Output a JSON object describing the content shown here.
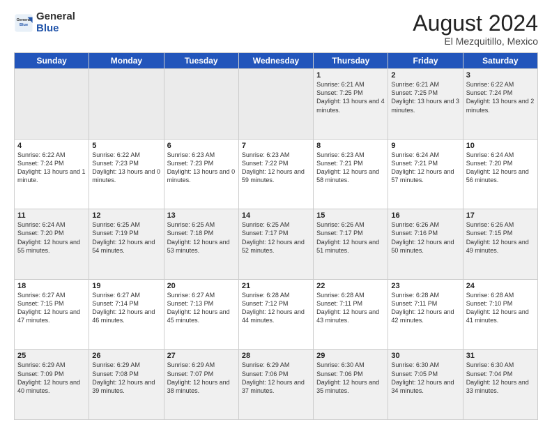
{
  "header": {
    "logo_general": "General",
    "logo_blue": "Blue",
    "title": "August 2024",
    "subtitle": "El Mezquitillo, Mexico"
  },
  "weekdays": [
    "Sunday",
    "Monday",
    "Tuesday",
    "Wednesday",
    "Thursday",
    "Friday",
    "Saturday"
  ],
  "weeks": [
    [
      {
        "num": "",
        "info": ""
      },
      {
        "num": "",
        "info": ""
      },
      {
        "num": "",
        "info": ""
      },
      {
        "num": "",
        "info": ""
      },
      {
        "num": "1",
        "info": "Sunrise: 6:21 AM\nSunset: 7:25 PM\nDaylight: 13 hours and 4 minutes."
      },
      {
        "num": "2",
        "info": "Sunrise: 6:21 AM\nSunset: 7:25 PM\nDaylight: 13 hours and 3 minutes."
      },
      {
        "num": "3",
        "info": "Sunrise: 6:22 AM\nSunset: 7:24 PM\nDaylight: 13 hours and 2 minutes."
      }
    ],
    [
      {
        "num": "4",
        "info": "Sunrise: 6:22 AM\nSunset: 7:24 PM\nDaylight: 13 hours and 1 minute."
      },
      {
        "num": "5",
        "info": "Sunrise: 6:22 AM\nSunset: 7:23 PM\nDaylight: 13 hours and 0 minutes."
      },
      {
        "num": "6",
        "info": "Sunrise: 6:23 AM\nSunset: 7:23 PM\nDaylight: 13 hours and 0 minutes."
      },
      {
        "num": "7",
        "info": "Sunrise: 6:23 AM\nSunset: 7:22 PM\nDaylight: 12 hours and 59 minutes."
      },
      {
        "num": "8",
        "info": "Sunrise: 6:23 AM\nSunset: 7:21 PM\nDaylight: 12 hours and 58 minutes."
      },
      {
        "num": "9",
        "info": "Sunrise: 6:24 AM\nSunset: 7:21 PM\nDaylight: 12 hours and 57 minutes."
      },
      {
        "num": "10",
        "info": "Sunrise: 6:24 AM\nSunset: 7:20 PM\nDaylight: 12 hours and 56 minutes."
      }
    ],
    [
      {
        "num": "11",
        "info": "Sunrise: 6:24 AM\nSunset: 7:20 PM\nDaylight: 12 hours and 55 minutes."
      },
      {
        "num": "12",
        "info": "Sunrise: 6:25 AM\nSunset: 7:19 PM\nDaylight: 12 hours and 54 minutes."
      },
      {
        "num": "13",
        "info": "Sunrise: 6:25 AM\nSunset: 7:18 PM\nDaylight: 12 hours and 53 minutes."
      },
      {
        "num": "14",
        "info": "Sunrise: 6:25 AM\nSunset: 7:17 PM\nDaylight: 12 hours and 52 minutes."
      },
      {
        "num": "15",
        "info": "Sunrise: 6:26 AM\nSunset: 7:17 PM\nDaylight: 12 hours and 51 minutes."
      },
      {
        "num": "16",
        "info": "Sunrise: 6:26 AM\nSunset: 7:16 PM\nDaylight: 12 hours and 50 minutes."
      },
      {
        "num": "17",
        "info": "Sunrise: 6:26 AM\nSunset: 7:15 PM\nDaylight: 12 hours and 49 minutes."
      }
    ],
    [
      {
        "num": "18",
        "info": "Sunrise: 6:27 AM\nSunset: 7:15 PM\nDaylight: 12 hours and 47 minutes."
      },
      {
        "num": "19",
        "info": "Sunrise: 6:27 AM\nSunset: 7:14 PM\nDaylight: 12 hours and 46 minutes."
      },
      {
        "num": "20",
        "info": "Sunrise: 6:27 AM\nSunset: 7:13 PM\nDaylight: 12 hours and 45 minutes."
      },
      {
        "num": "21",
        "info": "Sunrise: 6:28 AM\nSunset: 7:12 PM\nDaylight: 12 hours and 44 minutes."
      },
      {
        "num": "22",
        "info": "Sunrise: 6:28 AM\nSunset: 7:11 PM\nDaylight: 12 hours and 43 minutes."
      },
      {
        "num": "23",
        "info": "Sunrise: 6:28 AM\nSunset: 7:11 PM\nDaylight: 12 hours and 42 minutes."
      },
      {
        "num": "24",
        "info": "Sunrise: 6:28 AM\nSunset: 7:10 PM\nDaylight: 12 hours and 41 minutes."
      }
    ],
    [
      {
        "num": "25",
        "info": "Sunrise: 6:29 AM\nSunset: 7:09 PM\nDaylight: 12 hours and 40 minutes."
      },
      {
        "num": "26",
        "info": "Sunrise: 6:29 AM\nSunset: 7:08 PM\nDaylight: 12 hours and 39 minutes."
      },
      {
        "num": "27",
        "info": "Sunrise: 6:29 AM\nSunset: 7:07 PM\nDaylight: 12 hours and 38 minutes."
      },
      {
        "num": "28",
        "info": "Sunrise: 6:29 AM\nSunset: 7:06 PM\nDaylight: 12 hours and 37 minutes."
      },
      {
        "num": "29",
        "info": "Sunrise: 6:30 AM\nSunset: 7:06 PM\nDaylight: 12 hours and 35 minutes."
      },
      {
        "num": "30",
        "info": "Sunrise: 6:30 AM\nSunset: 7:05 PM\nDaylight: 12 hours and 34 minutes."
      },
      {
        "num": "31",
        "info": "Sunrise: 6:30 AM\nSunset: 7:04 PM\nDaylight: 12 hours and 33 minutes."
      }
    ]
  ]
}
